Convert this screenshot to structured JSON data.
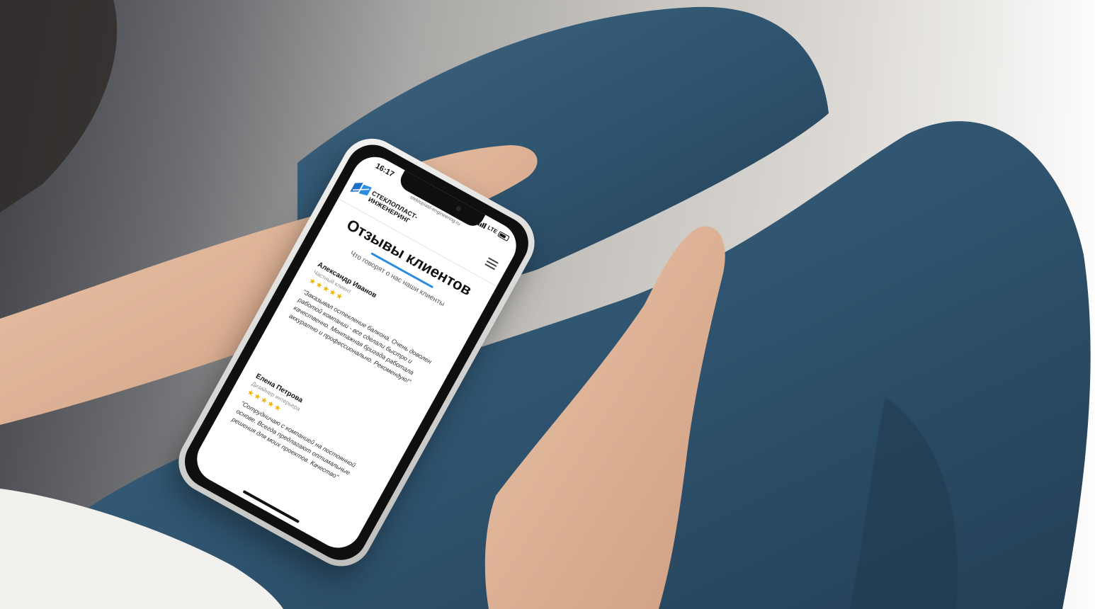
{
  "status_bar": {
    "time": "16:17",
    "network": "LTE"
  },
  "browser": {
    "url": "steklopiast-engineering.ru"
  },
  "site": {
    "logo_line1": "СТЕКЛОПЛАСТ-",
    "logo_line2": "ИНЖЕНЕРИНГ",
    "logo_color": "#1e6fc9",
    "menu_icon": "hamburger-menu-icon"
  },
  "page": {
    "title": "Отзывы клиентов",
    "subtitle": "Что говорят о нас наши клиенты",
    "accent_color": "#2b8de0"
  },
  "reviews": [
    {
      "name": "Александр Иванов",
      "role": "Частный клиент",
      "stars": "★★★★★",
      "rating": 5,
      "text": "\"Заказывал остекление балкона. Очень доволен работой компании - все сделали быстро и качественно. Монтажная бригада работала аккуратно и профессионально. Рекомендую!\""
    },
    {
      "name": "Елена Петрова",
      "role": "Дизайнер интерьера",
      "stars": "★★★★★",
      "rating": 5,
      "text": "\"Сотрудничаю с компанией на постоянной основе. Всегда предлагают оптимальные решения для моих проектов. Качество\""
    }
  ]
}
